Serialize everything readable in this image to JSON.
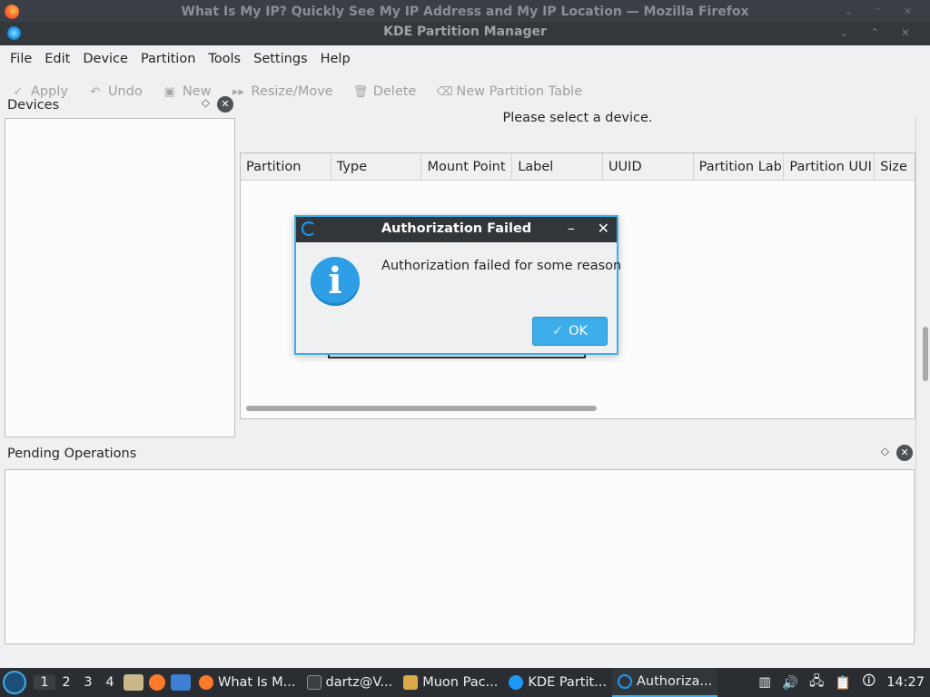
{
  "background_window": {
    "title": "What Is My IP? Quickly See My IP Address and My IP Location — Mozilla Firefox"
  },
  "window": {
    "title": "KDE Partition Manager"
  },
  "menubar": [
    "File",
    "Edit",
    "Device",
    "Partition",
    "Tools",
    "Settings",
    "Help"
  ],
  "toolbar": {
    "apply": "Apply",
    "undo": "Undo",
    "new": "New",
    "resize_move": "Resize/Move",
    "delete": "Delete",
    "new_partition_table": "New Partition Table"
  },
  "devices_panel": {
    "title": "Devices"
  },
  "main": {
    "message": "Please select a device.",
    "columns": [
      "Partition",
      "Type",
      "Mount Point",
      "Label",
      "UUID",
      "Partition Lab",
      "Partition UUI",
      "Size"
    ]
  },
  "pending_panel": {
    "title": "Pending Operations"
  },
  "dialog": {
    "title": "Authorization Failed",
    "message": "Authorization failed for some reason",
    "ok_label": "OK"
  },
  "taskbar": {
    "desktops": [
      "1",
      "2",
      "3",
      "4"
    ],
    "tasks": [
      "What Is M...",
      "dartz@V...",
      "Muon Pac...",
      "KDE Partit...",
      "Authoriza..."
    ],
    "clock": "14:27"
  },
  "colors": {
    "accent": "#3daee9",
    "titlebar": "#31363b",
    "taskbar": "#2a2e32"
  }
}
